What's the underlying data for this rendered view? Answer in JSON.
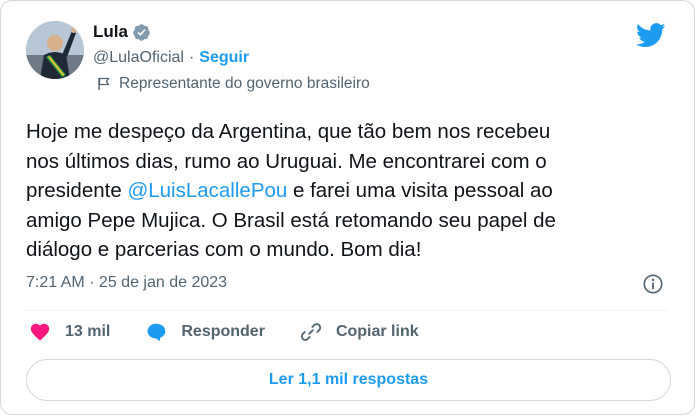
{
  "author": {
    "name": "Lula",
    "handle": "@LulaOficial",
    "separator": "·",
    "follow_label": "Seguir",
    "label": "Representante do governo brasileiro"
  },
  "tweet": {
    "text_before": "Hoje me despeço da Argentina, que tão bem nos recebeu\nnos últimos dias, rumo ao Uruguai. Me encontrarei com o\npresidente ",
    "mention": "@LuisLacallePou",
    "text_after": " e farei uma visita pessoal ao\namigo Pepe Mujica. O Brasil está retomando seu papel de\ndiálogo e parcerias com o mundo. Bom dia!",
    "timestamp": "7:21 AM · 25 de jan de 2023"
  },
  "actions": {
    "likes": "13 mil",
    "reply_label": "Responder",
    "copy_label": "Copiar link"
  },
  "replies_button": "Ler 1,1 mil respostas",
  "colors": {
    "accent": "#1d9bf0",
    "like": "#f91880",
    "muted": "#536471",
    "text": "#0f1419"
  }
}
